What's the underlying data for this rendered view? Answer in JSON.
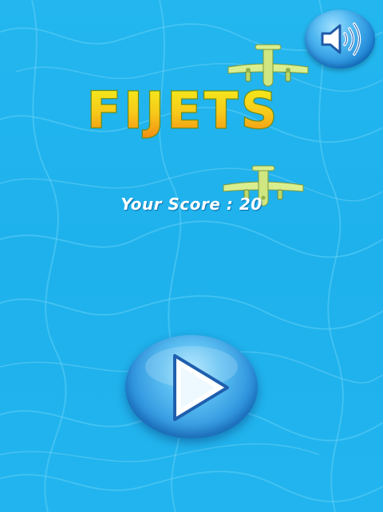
{
  "game": {
    "title": "FIJETS",
    "score_text": "Your Score : 20"
  },
  "controls": {
    "sound_icon": "speaker-icon",
    "play_icon": "play-icon"
  },
  "colors": {
    "water": "#1fb3ee",
    "title_top": "#f4f21c",
    "title_bottom": "#f28a12",
    "plane_body": "#d8ee8f"
  }
}
